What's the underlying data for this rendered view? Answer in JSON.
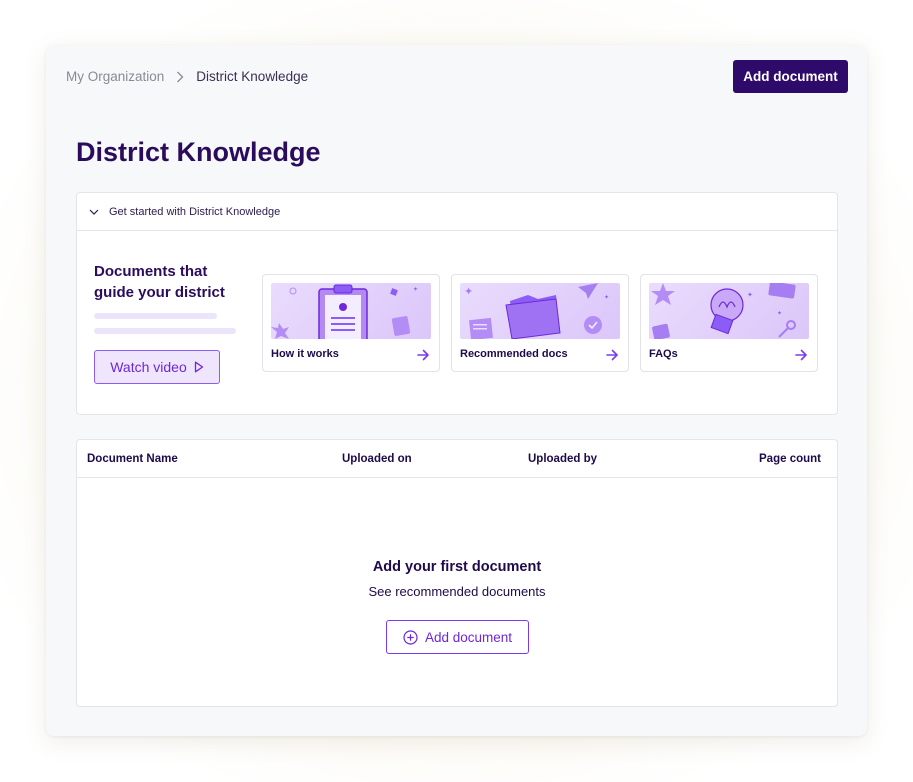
{
  "breadcrumb": {
    "root": "My Organization",
    "separator": "›",
    "current": "District Knowledge"
  },
  "header": {
    "add_document_label": "Add document"
  },
  "page": {
    "title": "District Knowledge"
  },
  "get_started": {
    "toggle_label": "Get started with District Knowledge",
    "intro_title": "Documents that guide your district",
    "watch_video_label": "Watch video",
    "cards": [
      {
        "label": "How it works",
        "icon": "clipboard-icon"
      },
      {
        "label": "Recommended docs",
        "icon": "folder-icon"
      },
      {
        "label": "FAQs",
        "icon": "lightbulb-icon"
      }
    ]
  },
  "table": {
    "columns": [
      "Document Name",
      "Uploaded on",
      "Uploaded by",
      "Page count"
    ],
    "rows": []
  },
  "empty_state": {
    "title": "Add your first document",
    "subtitle": "See recommended documents",
    "button_label": "Add document"
  },
  "colors": {
    "primary": "#2e0a6b",
    "accent": "#7c3aed",
    "accent_light": "#efe5fd",
    "title": "#2b0c5c"
  }
}
